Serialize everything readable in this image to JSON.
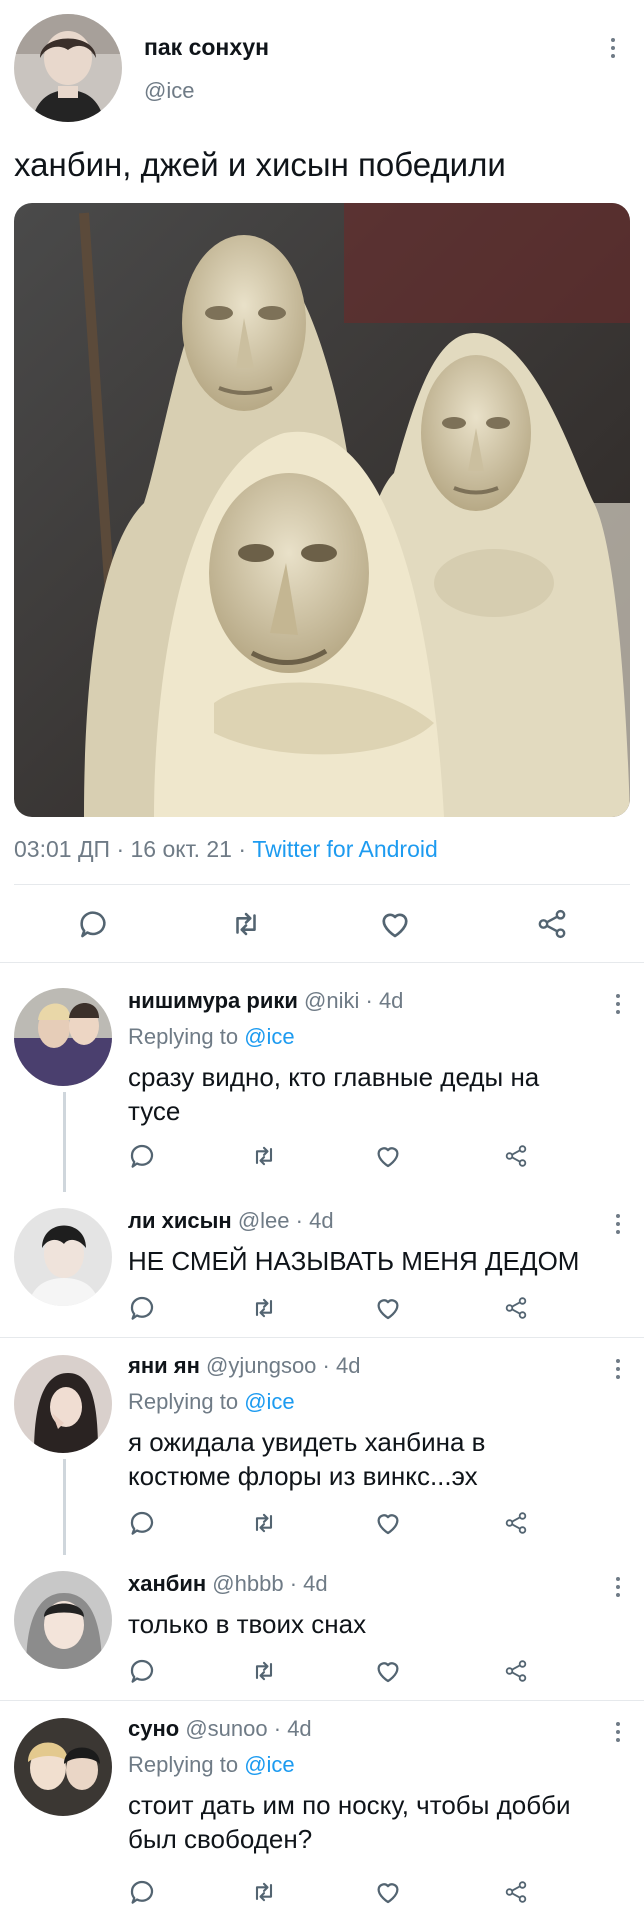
{
  "tweet": {
    "author_name": "пак сонхун",
    "author_handle": "@ice",
    "text": "ханбин, джей и хисын победили",
    "image_alt": "three elderly witch figures",
    "meta": {
      "time": "03:01 ДП",
      "date": "16 окт. 21",
      "source": "Twitter for Android",
      "sep": "·"
    }
  },
  "replies": [
    {
      "name": "нишимура рики",
      "handle": "@niki",
      "age": "4d",
      "replying_label": "Replying to",
      "replying_to": "@ice",
      "text": "сразу видно, кто главные деды на тусе"
    },
    {
      "name": "ли хисын",
      "handle": "@lee",
      "age": "4d",
      "text": "НЕ СМЕЙ НАЗЫВАТЬ МЕНЯ ДЕДОМ"
    },
    {
      "name": "яни ян",
      "handle": "@yjungsoo",
      "age": "4d",
      "replying_label": "Replying to",
      "replying_to": "@ice",
      "text": "я ожидала увидеть ханбина в костюме флоры из винкс...эх"
    },
    {
      "name": "ханбин",
      "handle": "@hbbb",
      "age": "4d",
      "text": "только в твоих снах"
    },
    {
      "name": "суно",
      "handle": "@sunoo",
      "age": "4d",
      "replying_label": "Replying to",
      "replying_to": "@ice",
      "text": "стоит дать им по носку, чтобы добби был свободен?"
    }
  ],
  "icons": {
    "reply": "reply-icon",
    "retweet": "retweet-icon",
    "like": "like-icon",
    "share": "share-icon",
    "more": "more-icon"
  },
  "colors": {
    "text": "#0f1419",
    "muted": "#6f7b86",
    "link": "#1d9bf0",
    "divider": "#e6e9ec"
  }
}
